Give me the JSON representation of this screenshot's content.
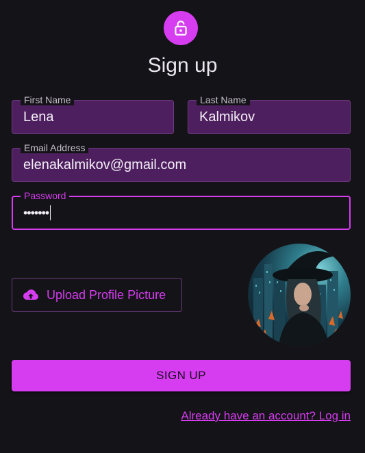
{
  "header": {
    "title": "Sign up",
    "icon": "lock-open-icon",
    "badge_color": "#d63cf0"
  },
  "form": {
    "first_name": {
      "label": "First Name",
      "value": "Lena"
    },
    "last_name": {
      "label": "Last Name",
      "value": "Kalmikov"
    },
    "email": {
      "label": "Email Address",
      "value": "elenakalmikov@gmail.com"
    },
    "password": {
      "label": "Password",
      "value": "•••••••"
    }
  },
  "upload": {
    "label": "Upload Profile Picture",
    "icon": "cloud-upload-icon"
  },
  "submit": {
    "label": "SIGN UP"
  },
  "footer": {
    "login_link": "Already have an account? Log in"
  },
  "colors": {
    "accent": "#d63cf0",
    "background": "#141317",
    "field_fill": "#4e1f5e"
  }
}
